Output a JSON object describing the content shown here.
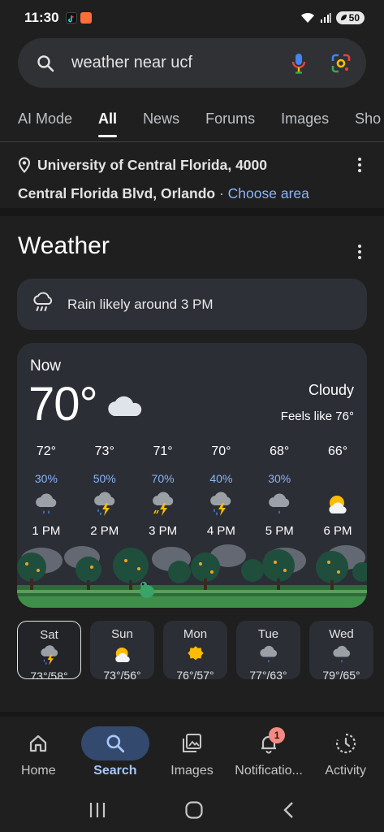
{
  "status": {
    "time": "11:30",
    "battery": "50"
  },
  "search": {
    "query": "weather near ucf"
  },
  "tabs": [
    "AI Mode",
    "All",
    "News",
    "Forums",
    "Images",
    "Sho"
  ],
  "location": {
    "line1": "University of Central Florida, 4000",
    "line2": "Central Florida Blvd, Orlando",
    "separator": "·",
    "choose_area": "Choose area"
  },
  "weather": {
    "title": "Weather",
    "rain_alert": "Rain likely around 3 PM",
    "now_label": "Now",
    "temperature": "70°",
    "condition": "Cloudy",
    "feels_like": "Feels like 76°",
    "hourly": [
      {
        "temp": "72°",
        "precip": "30%",
        "icon": "rain-cloud-icon",
        "hour": "1 PM"
      },
      {
        "temp": "73°",
        "precip": "50%",
        "icon": "thunderstorm-rain-icon",
        "hour": "2 PM"
      },
      {
        "temp": "71°",
        "precip": "70%",
        "icon": "thunderstorm-icon",
        "hour": "3 PM"
      },
      {
        "temp": "70°",
        "precip": "40%",
        "icon": "thunderstorm-rain-icon",
        "hour": "4 PM"
      },
      {
        "temp": "68°",
        "precip": "30%",
        "icon": "rain-cloud-icon",
        "hour": "5 PM"
      },
      {
        "temp": "66°",
        "precip": "",
        "icon": "partly-cloudy-icon",
        "hour": "6 PM"
      }
    ],
    "daily": [
      {
        "day": "Sat",
        "range": "73°/58°",
        "icon": "thunderstorm-rain-icon",
        "selected": true
      },
      {
        "day": "Sun",
        "range": "73°/56°",
        "icon": "partly-cloudy-icon"
      },
      {
        "day": "Mon",
        "range": "76°/57°",
        "icon": "sun-icon"
      },
      {
        "day": "Tue",
        "range": "77°/63°",
        "icon": "rain-cloud-icon"
      },
      {
        "day": "Wed",
        "range": "79°/65°",
        "icon": "rain-cloud-icon"
      }
    ]
  },
  "nav": {
    "items": [
      {
        "label": "Home",
        "icon": "home-icon"
      },
      {
        "label": "Search",
        "icon": "search-icon",
        "active": true
      },
      {
        "label": "Images",
        "icon": "images-icon"
      },
      {
        "label": "Notificatio...",
        "icon": "bell-icon",
        "badge": "1"
      },
      {
        "label": "Activity",
        "icon": "activity-icon"
      }
    ]
  },
  "colors": {
    "background": "#1f1f1f",
    "card": "#2b2e35",
    "accent_blue": "#8ab4f8",
    "nav_active_pill": "#334a6e"
  }
}
